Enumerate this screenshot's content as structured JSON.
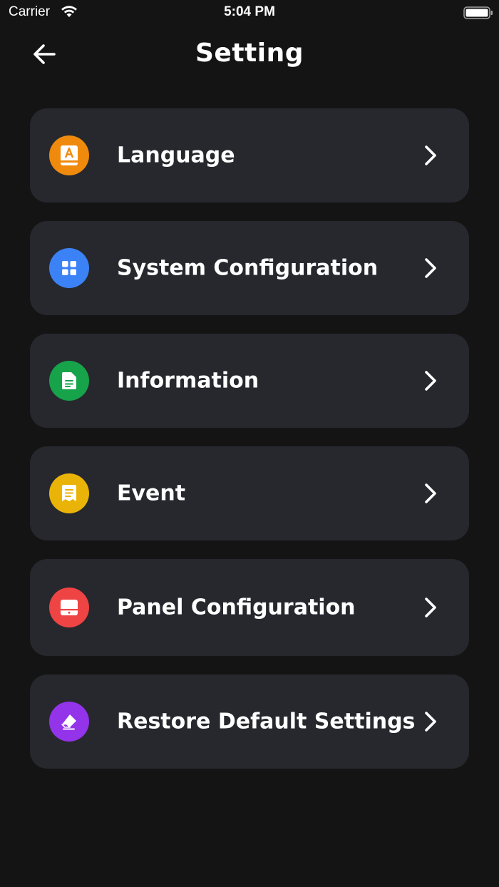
{
  "status_bar": {
    "carrier": "Carrier",
    "time": "5:04 PM"
  },
  "header": {
    "title": "Setting",
    "back_icon": "arrow-left-icon"
  },
  "colors": {
    "background": "#141414",
    "card": "#27282e",
    "language": "#ef8a0c",
    "system_configuration": "#3b82f6",
    "information": "#16a34a",
    "event": "#eab308",
    "panel_configuration": "#ef4444",
    "restore_default_settings": "#9333ea"
  },
  "menu": {
    "items": [
      {
        "label": "Language",
        "icon": "book-a-icon"
      },
      {
        "label": "System Configuration",
        "icon": "grid-icon"
      },
      {
        "label": "Information",
        "icon": "document-icon"
      },
      {
        "label": "Event",
        "icon": "note-icon"
      },
      {
        "label": "Panel Configuration",
        "icon": "panel-icon"
      },
      {
        "label": "Restore Default Settings",
        "icon": "eraser-icon"
      }
    ]
  }
}
